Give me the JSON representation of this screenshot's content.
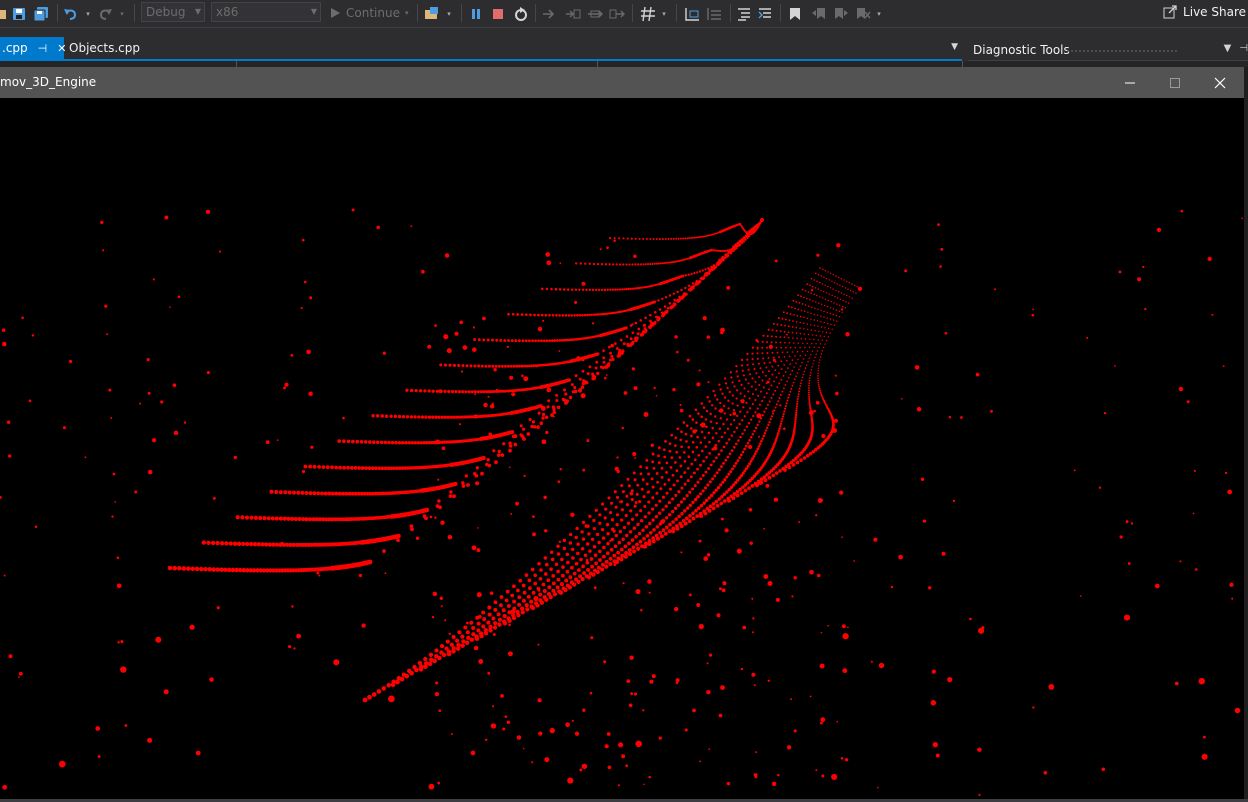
{
  "toolbar": {
    "config_value": "Debug",
    "platform_value": "x86",
    "continue_label": "Continue",
    "live_share_label": "Live Share",
    "icons": [
      "open-folder-icon",
      "save-icon",
      "save-all-icon",
      "undo-icon",
      "redo-icon",
      "play-icon",
      "process-icon",
      "pause-icon",
      "stop-icon",
      "restart-icon",
      "step-into-icon",
      "step-over-icon",
      "step-out-icon",
      "threads-icon",
      "code-map-icon",
      "comment-icon",
      "uncomment-icon",
      "bookmark-icon",
      "prev-bookmark-icon",
      "next-bookmark-icon",
      "clear-bookmark-icon",
      "live-share-icon"
    ]
  },
  "editor": {
    "tabs": [
      {
        "label": ".cpp",
        "active": true
      },
      {
        "label": "Objects.cpp",
        "active": false
      }
    ]
  },
  "diagnostic_tools": {
    "title": "Diagnostic Tools"
  },
  "app_window": {
    "title": "mov_3D_Engine",
    "point_color": "#ff0000",
    "background_color": "#000000"
  },
  "colors": {
    "ide_background": "#2d2d30",
    "accent": "#007acc",
    "titlebar": "#535353"
  }
}
